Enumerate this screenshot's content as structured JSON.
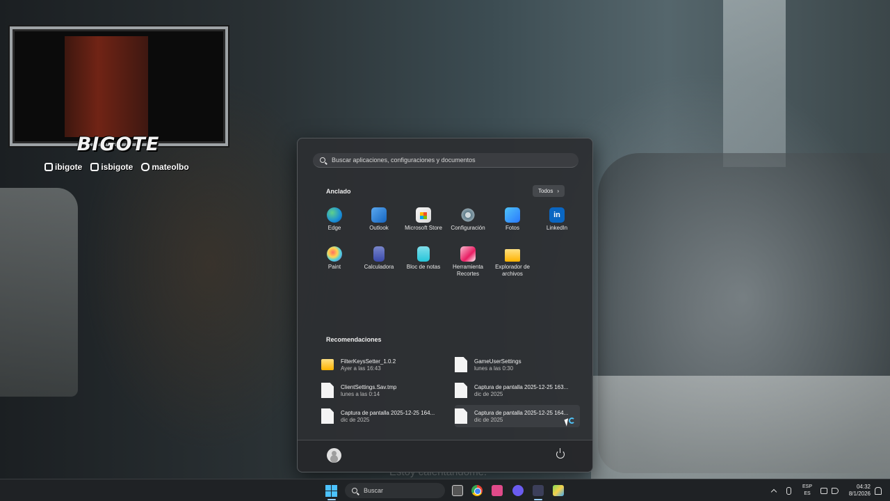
{
  "overlay": {
    "brand": "BIGOTE",
    "socials": [
      {
        "icon": "twitch-kick-icon",
        "handle": "ibigote"
      },
      {
        "icon": "tiktok-icon",
        "handle": "isbigote"
      },
      {
        "icon": "instagram-icon",
        "handle": "mateolbo"
      }
    ]
  },
  "start_menu": {
    "search_placeholder": "Buscar aplicaciones, configuraciones y documentos",
    "pinned_title": "Anclado",
    "all_button": "Todos",
    "pinned": [
      {
        "label": "Edge",
        "icon": "edge"
      },
      {
        "label": "Outlook",
        "icon": "outlook"
      },
      {
        "label": "Microsoft Store",
        "icon": "store"
      },
      {
        "label": "Configuración",
        "icon": "config"
      },
      {
        "label": "Fotos",
        "icon": "fotos"
      },
      {
        "label": "LinkedIn",
        "icon": "linkedin"
      },
      {
        "label": "Paint",
        "icon": "paint"
      },
      {
        "label": "Calculadora",
        "icon": "calc"
      },
      {
        "label": "Bloc de notas",
        "icon": "bloc"
      },
      {
        "label": "Herramienta Recortes",
        "icon": "recortes"
      },
      {
        "label": "Explorador de archivos",
        "icon": "explorer"
      }
    ],
    "recommended_title": "Recomendaciones",
    "recommended": [
      {
        "name": "FilterKeysSetter_1.0.2",
        "time": "Ayer a las 16:43",
        "icon": "folder"
      },
      {
        "name": "GameUserSettings",
        "time": "lunes a las 0:30",
        "icon": "file"
      },
      {
        "name": "ClientSettings.Sav.tmp",
        "time": "lunes a las 0:14",
        "icon": "file"
      },
      {
        "name": "Captura de pantalla 2025-12-25 163...",
        "time": "dic de 2025",
        "icon": "file"
      },
      {
        "name": "Captura de pantalla 2025-12-25 164...",
        "time": "dic de 2025",
        "icon": "file"
      },
      {
        "name": "Captura de pantalla 2025-12-25 164...",
        "time": "dic de 2025",
        "icon": "file"
      }
    ]
  },
  "subtitle": "Estoy calentándome.",
  "taskbar": {
    "search_label": "Buscar",
    "lang_top": "ESP",
    "lang_bottom": "ES",
    "time": "04:32",
    "date": "8/1/2026"
  }
}
